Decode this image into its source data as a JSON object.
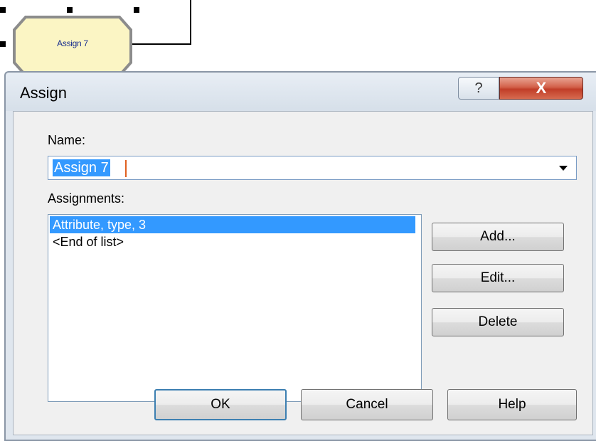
{
  "canvas": {
    "module_label": "Assign 7",
    "module_fill": "#fbf5c4"
  },
  "dialog": {
    "title": "Assign",
    "help_glyph": "?",
    "close_glyph": "X",
    "name_label": "Name:",
    "name_value": "Assign 7",
    "assignments_label": "Assignments:",
    "assignments": [
      {
        "text": "Attribute, type, 3",
        "selected": true
      },
      {
        "text": "<End of list>",
        "selected": false
      }
    ],
    "buttons": {
      "add": "Add...",
      "edit": "Edit...",
      "delete": "Delete",
      "ok": "OK",
      "cancel": "Cancel",
      "help": "Help"
    },
    "selection_color": "#3399ff",
    "close_color": "#c94a33"
  }
}
